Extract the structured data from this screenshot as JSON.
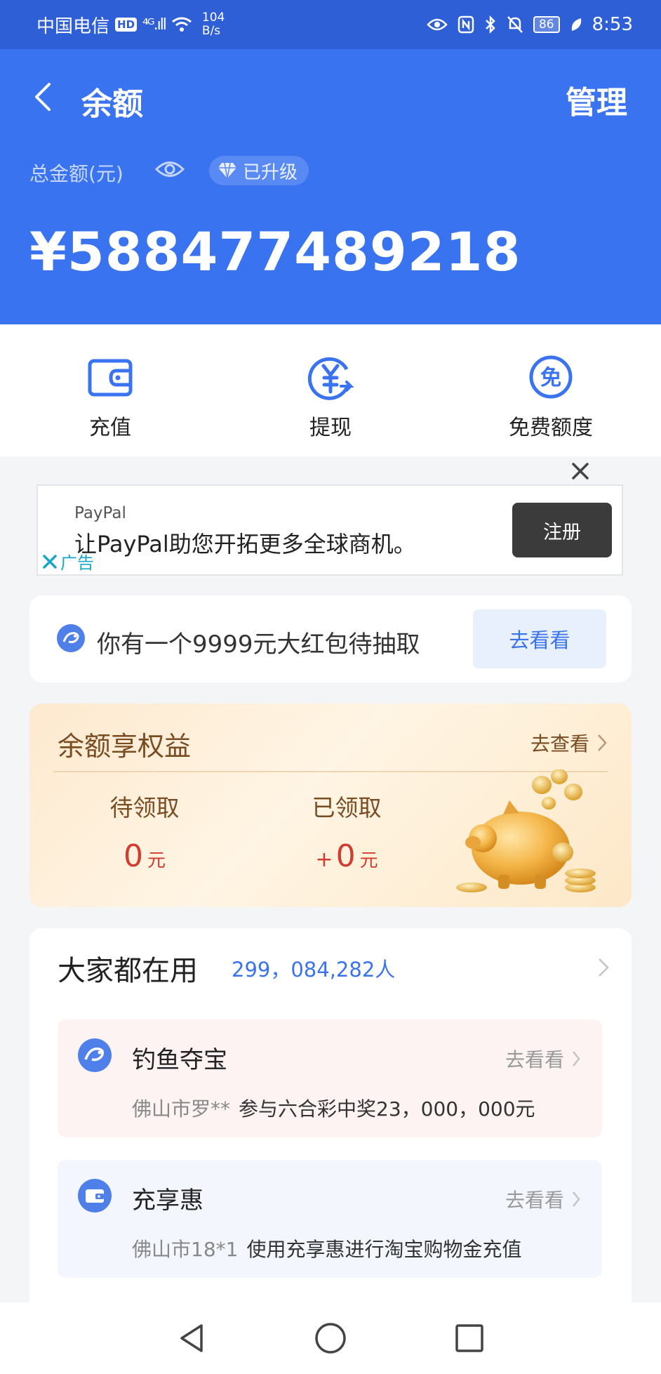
{
  "status_bar": {
    "carrier": "中国电信",
    "hd": "HD",
    "signal": "⁴ᴳ.ıll",
    "speed_value": "104",
    "speed_unit": "B/s",
    "battery": "86",
    "time": "8:53"
  },
  "header": {
    "title": "余额",
    "manage_label": "管理",
    "total_label": "总金额(元)",
    "upgraded_label": "已升级",
    "amount": "¥588477489218"
  },
  "actions": [
    {
      "label": "充值",
      "icon": "wallet-icon"
    },
    {
      "label": "提现",
      "icon": "withdraw-icon"
    },
    {
      "label": "免费额度",
      "icon": "free-quota-icon"
    }
  ],
  "ad": {
    "brand": "PayPal",
    "text": "让PayPal助您开拓更多全球商机。",
    "cta": "注册",
    "tag": "广告"
  },
  "red_packet": {
    "text": "你有一个9999元大红包待抽取",
    "button": "去看看"
  },
  "benefits": {
    "title": "余额享权益",
    "more": "去查看",
    "pending_label": "待领取",
    "pending_value": "0",
    "received_label": "已领取",
    "received_prefix": "+",
    "received_value": "0",
    "unit": "元"
  },
  "popular": {
    "title": "大家都在用",
    "count": "299，084,282人",
    "items": [
      {
        "name": "钓鱼夺宝",
        "go": "去看看",
        "who": "佛山市罗**",
        "desc": "参与六合彩中奖23，000，000元",
        "bg": "#fdf3f3"
      },
      {
        "name": "充享惠",
        "go": "去看看",
        "who": "佛山市18*1",
        "desc": "使用充享惠进行淘宝购物金充值",
        "bg": "#f3f6fd"
      }
    ]
  },
  "colors": {
    "header_bg": "#3a73f0",
    "status_bg": "#2f5fd6",
    "accent": "#3a73f0",
    "benefit_value": "#d23c30"
  }
}
